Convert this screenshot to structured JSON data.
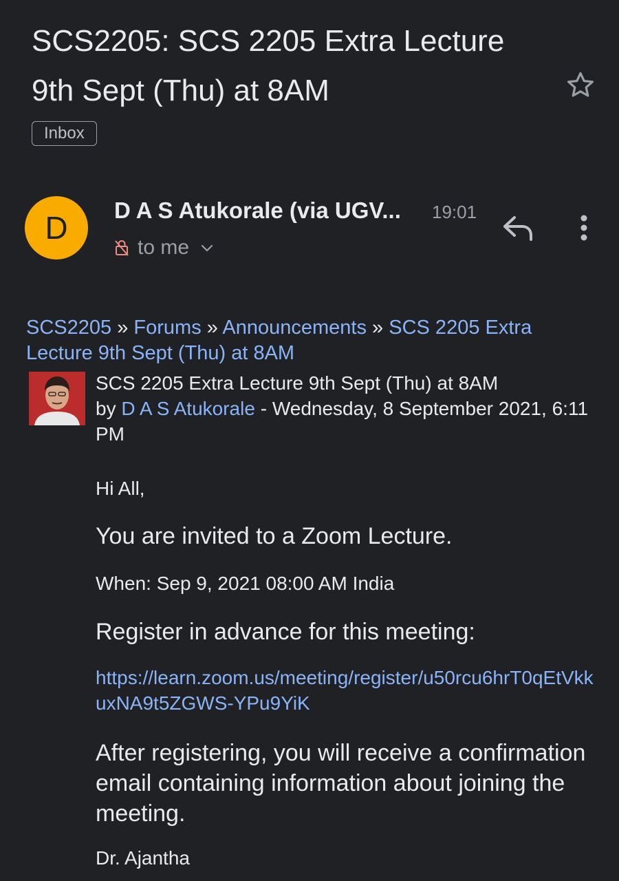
{
  "email": {
    "subject": "SCS2205: SCS 2205 Extra Lecture 9th Sept (Thu) at 8AM",
    "label": "Inbox",
    "sender": {
      "avatar_letter": "D",
      "avatar_color": "#f9ab00",
      "name": "D A S Atukorale (via UGV...",
      "time": "19:01",
      "recipient": "to me"
    },
    "icons": {
      "star": "star-icon",
      "reply": "reply-icon",
      "more": "more-vert-icon",
      "lock": "lock-off-icon",
      "chevron": "chevron-down-icon"
    },
    "body": {
      "breadcrumb": {
        "course": "SCS2205",
        "separator": "»",
        "forums": "Forums",
        "announcements": "Announcements",
        "topic": "SCS 2205 Extra Lecture 9th Sept (Thu) at 8AM"
      },
      "post": {
        "title": "SCS 2205 Extra Lecture 9th Sept (Thu) at 8AM",
        "by": "by",
        "author": "D A S Atukorale",
        "date": " - Wednesday, 8 September 2021, 6:11 PM"
      },
      "greeting": "Hi All,",
      "invite": "You are invited to a Zoom Lecture.",
      "when": "When: Sep 9, 2021 08:00 AM India",
      "register": "Register in advance for this meeting:",
      "link": "https://learn.zoom.us/meeting/register/u50rcu6hrT0qEtVkkuxNA9t5ZGWS-YPu9YiK",
      "after": "After registering, you will receive a confirmation email containing information about joining the meeting.",
      "signature": "Dr. Ajantha"
    }
  },
  "colors": {
    "background": "#202124",
    "text": "#e8eaed",
    "link": "#8ab4f8",
    "muted": "#9aa0a6",
    "lock": "#f28b82"
  }
}
